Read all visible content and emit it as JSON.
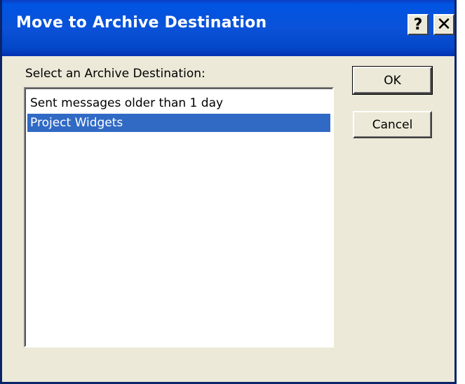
{
  "window": {
    "title": "Move to Archive Destination",
    "help_label": "?",
    "close_label": "✕"
  },
  "dialog": {
    "prompt": "Select an Archive Destination:",
    "items": [
      {
        "label": "Sent messages older than 1 day",
        "selected": false
      },
      {
        "label": "Project Widgets",
        "selected": true
      }
    ],
    "ok_label": "OK",
    "cancel_label": "Cancel"
  },
  "colors": {
    "titlebar": "#0054e3",
    "selection": "#316ac5",
    "dialog_bg": "#ece9d8"
  }
}
